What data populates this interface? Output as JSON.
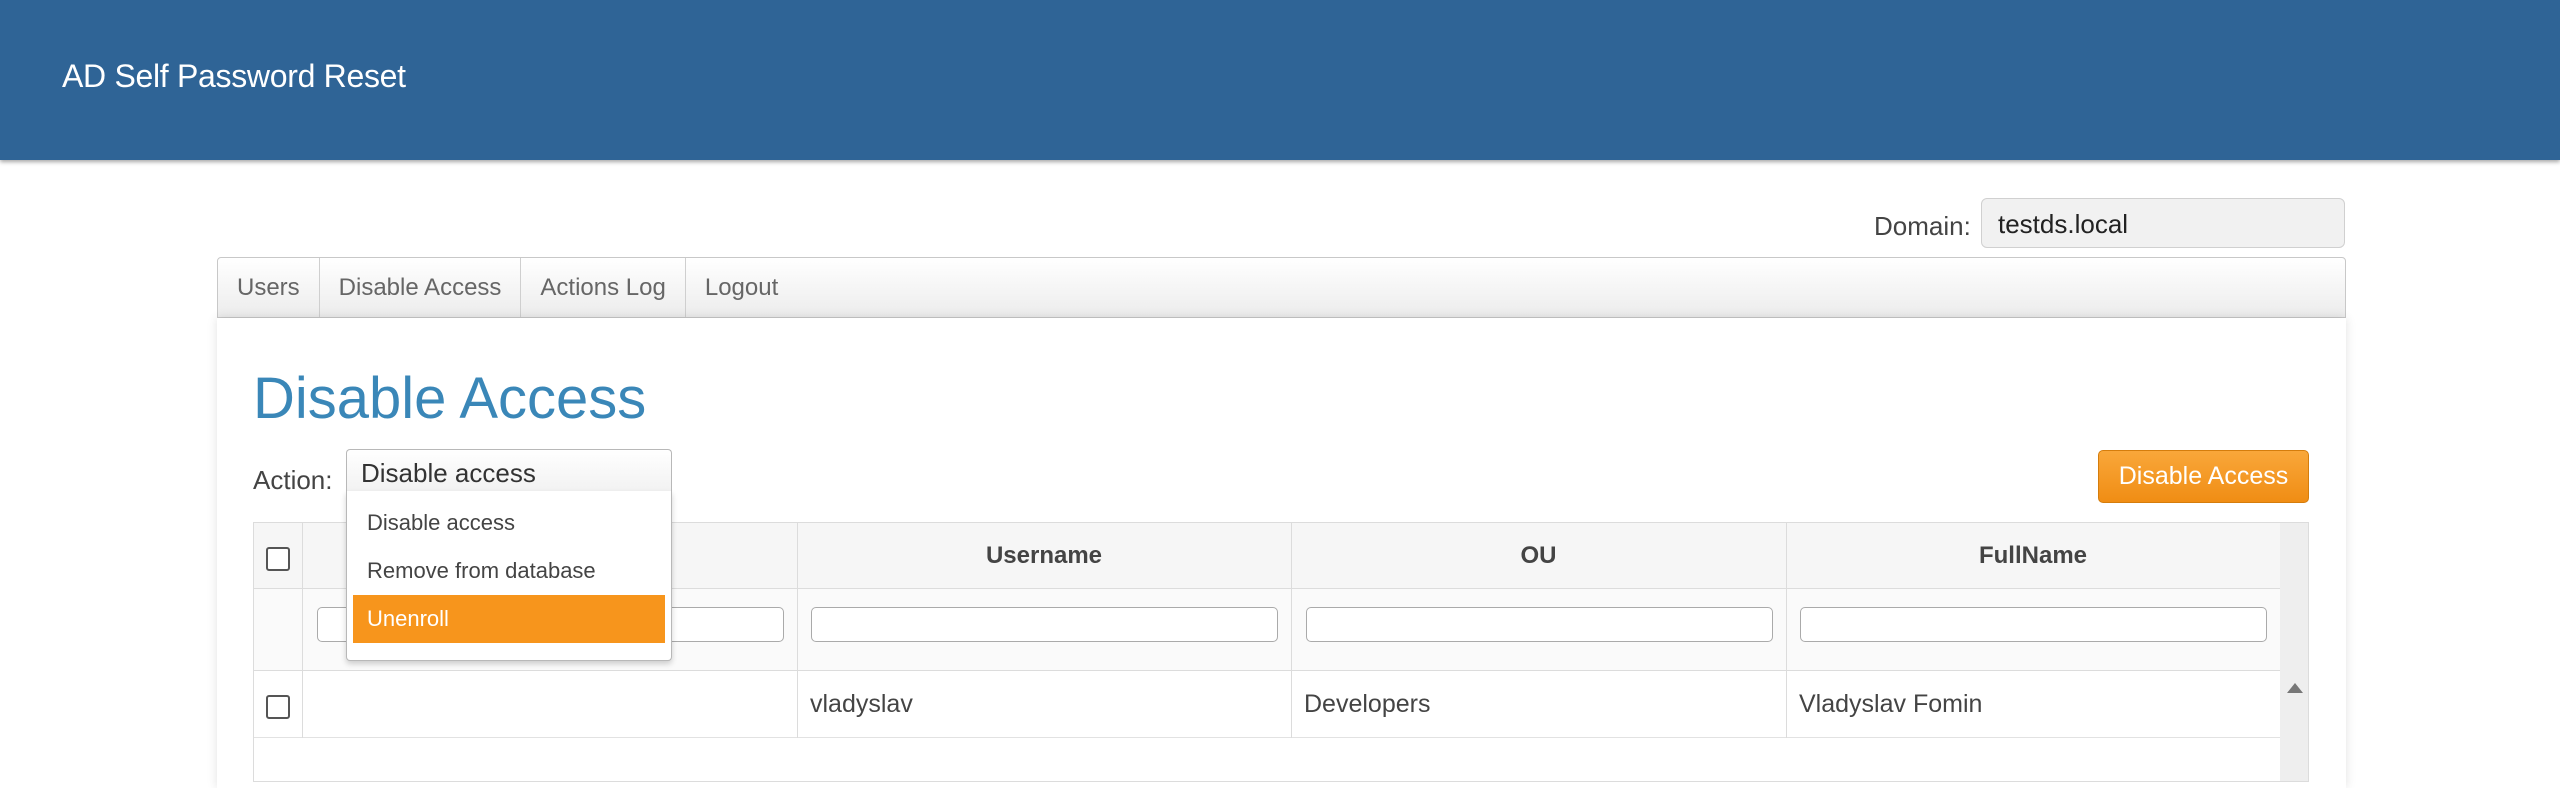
{
  "header": {
    "title": "AD Self Password Reset"
  },
  "domain": {
    "label": "Domain:",
    "value": "testds.local"
  },
  "tabs": [
    {
      "label": "Users"
    },
    {
      "label": "Disable Access"
    },
    {
      "label": "Actions Log"
    },
    {
      "label": "Logout"
    }
  ],
  "page": {
    "title": "Disable Access"
  },
  "action": {
    "label": "Action:",
    "selected": "Disable access",
    "options": [
      "Disable access",
      "Remove from database",
      "Unenroll"
    ],
    "highlighted": "Unenroll"
  },
  "button": {
    "label": "Disable Access"
  },
  "table": {
    "columns": [
      "Username",
      "OU",
      "FullName"
    ],
    "rows": [
      {
        "username": "vladyslav",
        "ou": "Developers",
        "fullname": "Vladyslav Fomin"
      }
    ]
  },
  "colors": {
    "header_bg": "#2f6496",
    "accent": "#f7951c",
    "title": "#3a87b8"
  }
}
